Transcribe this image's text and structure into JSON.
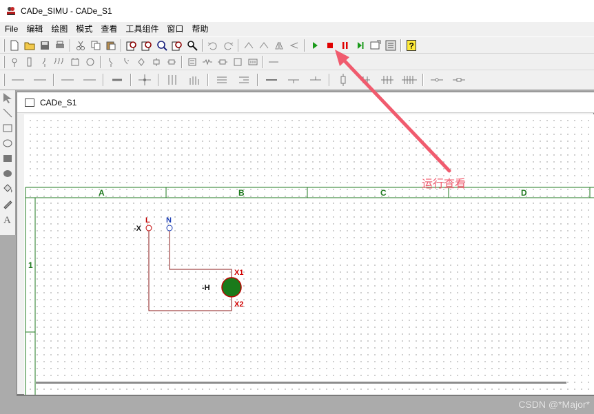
{
  "window": {
    "title": "CADe_SIMU - CADe_S1"
  },
  "menu": {
    "items": [
      "File",
      "编辑",
      "绘图",
      "模式",
      "查看",
      "工具组件",
      "窗口",
      "帮助"
    ]
  },
  "child_window": {
    "title": "CADe_S1"
  },
  "sheet": {
    "columns": [
      "A",
      "B",
      "C",
      "D"
    ],
    "rows": [
      "1"
    ]
  },
  "schematic": {
    "terminal_prefix": "-X",
    "terminal_L": "L",
    "terminal_N": "N",
    "lamp_label": "-H",
    "lamp_x1": "X1",
    "lamp_x2": "X2"
  },
  "annotation": {
    "text": "运行查看"
  },
  "watermark": "CSDN @*Major*",
  "colors": {
    "frame_green": "#1f7a1f",
    "wire": "#8b1a1a",
    "lamp_fill": "#1a7a1a",
    "lamp_ring": "#c00000",
    "label_red": "#d00000",
    "label_blue": "#1a3db3",
    "arrow": "#f05b6e"
  }
}
